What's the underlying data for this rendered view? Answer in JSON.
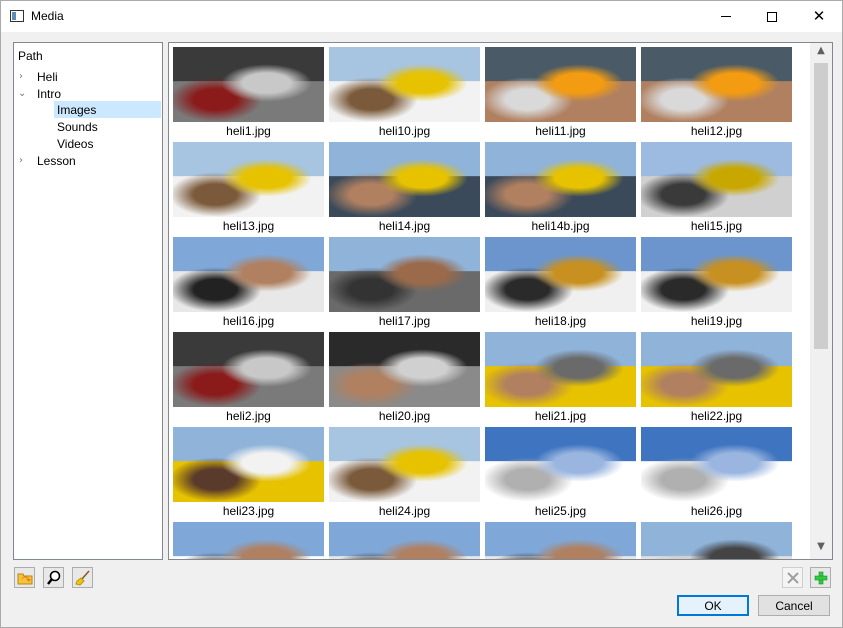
{
  "window": {
    "title": "Media"
  },
  "tree": {
    "header": "Path",
    "items": [
      {
        "label": "Heli",
        "expanded": false
      },
      {
        "label": "Intro",
        "expanded": true
      },
      {
        "label": "Images",
        "selected": true
      },
      {
        "label": "Sounds"
      },
      {
        "label": "Videos"
      },
      {
        "label": "Lesson",
        "expanded": false
      }
    ]
  },
  "images": [
    {
      "name": "heli1.jpg",
      "icon": "interior-scene"
    },
    {
      "name": "heli10.jpg",
      "icon": "submarine-deck"
    },
    {
      "name": "heli11.jpg",
      "icon": "woman-orange-top"
    },
    {
      "name": "heli12.jpg",
      "icon": "woman-orange-top"
    },
    {
      "name": "heli13.jpg",
      "icon": "submarine-deck"
    },
    {
      "name": "heli14.jpg",
      "icon": "woman-on-sub"
    },
    {
      "name": "heli14b.jpg",
      "icon": "woman-on-sub"
    },
    {
      "name": "heli15.jpg",
      "icon": "ship-rigging"
    },
    {
      "name": "heli16.jpg",
      "icon": "people-railing"
    },
    {
      "name": "heli17.jpg",
      "icon": "woman-closeup"
    },
    {
      "name": "heli18.jpg",
      "icon": "woman-railing"
    },
    {
      "name": "heli19.jpg",
      "icon": "woman-railing"
    },
    {
      "name": "heli2.jpg",
      "icon": "interior-scene"
    },
    {
      "name": "heli20.jpg",
      "icon": "man-deck"
    },
    {
      "name": "heli21.jpg",
      "icon": "men-deck"
    },
    {
      "name": "heli22.jpg",
      "icon": "men-deck"
    },
    {
      "name": "heli23.jpg",
      "icon": "people-sub"
    },
    {
      "name": "heli24.jpg",
      "icon": "submarine-deck"
    },
    {
      "name": "heli25.jpg",
      "icon": "railing-sky"
    },
    {
      "name": "heli26.jpg",
      "icon": "railing-sky"
    },
    {
      "name": "",
      "icon": "woman-sky"
    },
    {
      "name": "",
      "icon": "people-railing"
    },
    {
      "name": "",
      "icon": "people-railing"
    },
    {
      "name": "",
      "icon": "ship-deck"
    }
  ],
  "toolbar": {
    "icons": [
      "folder-icon",
      "zoom-icon",
      "broom-icon"
    ]
  },
  "actions": {
    "ok": "OK",
    "cancel": "Cancel"
  }
}
